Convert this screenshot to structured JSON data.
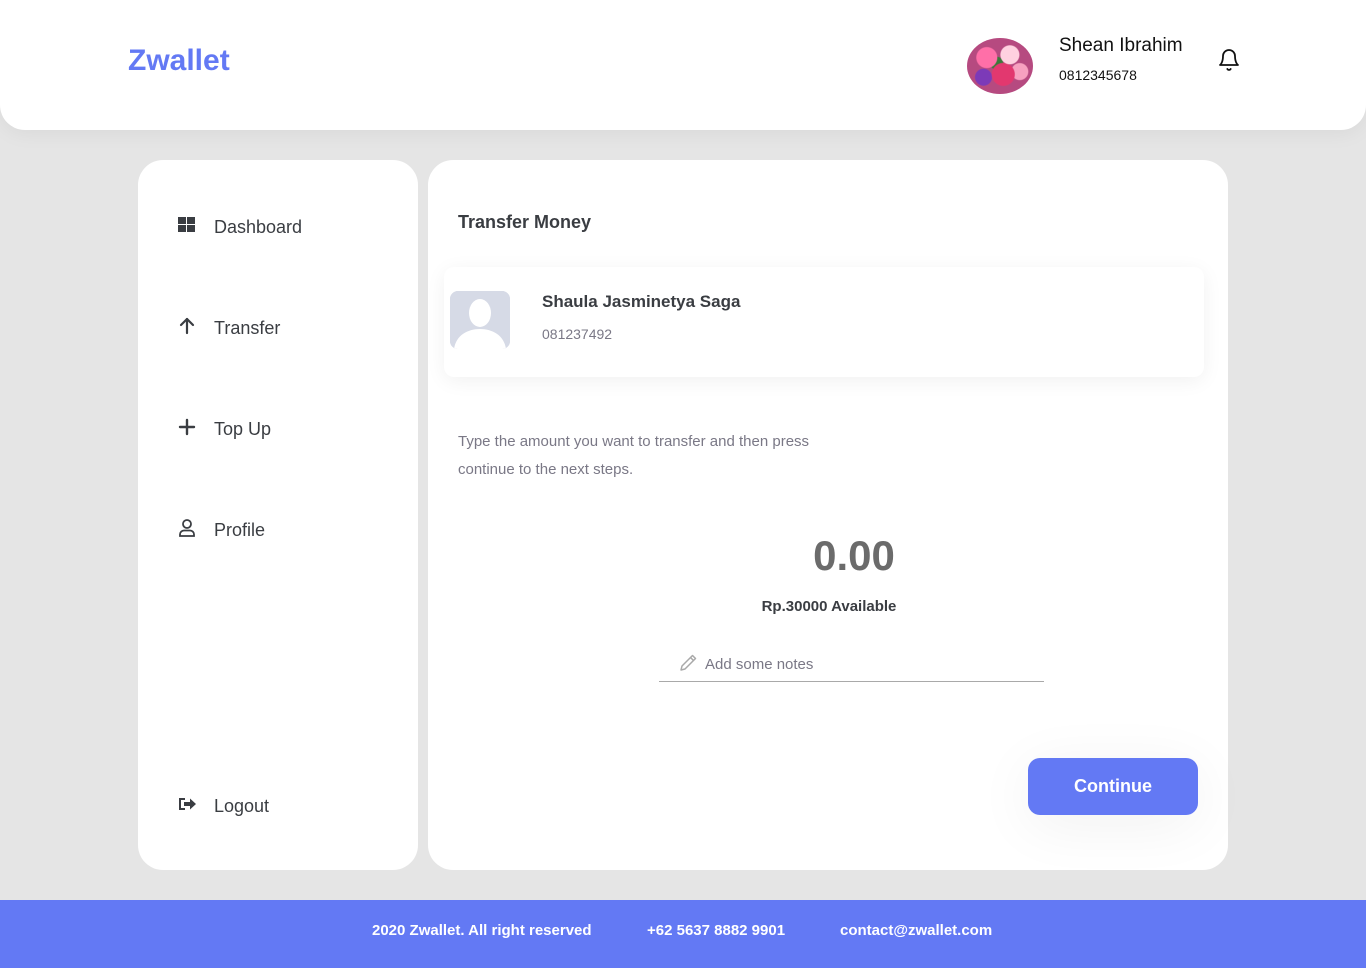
{
  "app": {
    "logo": "Zwallet"
  },
  "header": {
    "user_name": "Shean Ibrahim",
    "user_phone": "0812345678",
    "avatar_icon": "user-avatar",
    "notification_icon": "bell-icon"
  },
  "sidebar": {
    "items": [
      {
        "label": "Dashboard",
        "icon": "dashboard-icon"
      },
      {
        "label": "Transfer",
        "icon": "arrow-up-icon"
      },
      {
        "label": "Top Up",
        "icon": "plus-icon"
      },
      {
        "label": "Profile",
        "icon": "user-icon"
      }
    ],
    "logout": {
      "label": "Logout",
      "icon": "logout-icon"
    }
  },
  "main": {
    "title": "Transfer Money",
    "receiver": {
      "name": "Shaula Jasminetya Saga",
      "phone": "081237492"
    },
    "instructions": "Type the amount you want to transfer and then press continue to the next steps.",
    "amount": "0.00",
    "available": "Rp.30000 Available",
    "notes_placeholder": "Add some notes",
    "continue_label": "Continue"
  },
  "footer": {
    "copyright": "2020 Zwallet. All right reserved",
    "phone": "+62 5637 8882 9901",
    "email": "contact@zwallet.com"
  },
  "colors": {
    "accent": "#6379f4",
    "background": "#e5e5e5",
    "card": "#ffffff",
    "text": "#3a3d42",
    "muted": "#7a7886"
  }
}
